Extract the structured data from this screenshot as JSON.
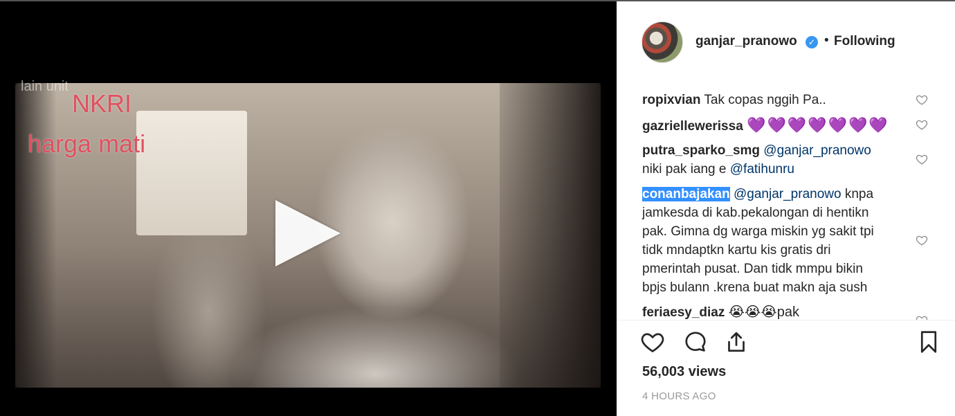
{
  "video": {
    "overlay_top": "lain unit",
    "overlay_line1": "NKRI",
    "overlay_line2": "harga mati"
  },
  "header": {
    "username": "ganjar_pranowo",
    "separator": "•",
    "follow_status": "Following"
  },
  "comments": [
    {
      "user": "ropixvian",
      "text": "Tak copas nggih Pa.."
    },
    {
      "user": "gazriellewerissa",
      "text": "💜💜💜💜💜💜💜"
    },
    {
      "user": "putra_sparko_smg",
      "mention": "@ganjar_pranowo",
      "text_line2": "niki pak iang e",
      "mention2": "@fatihunru"
    },
    {
      "user": "conanbajakan",
      "mention": "@ganjar_pranowo",
      "text_a": "knpa",
      "text_b": "jamkesda di kab.pekalongan di hentikn",
      "text_c": "pak. Gimna dg warga miskin yg sakit tpi",
      "text_d": "tidk mndaptkn kartu kis gratis dri",
      "text_e": "pmerintah pusat. Dan tidk mmpu bikin",
      "text_f": "bpjs bulann .krena buat makn aja sush"
    },
    {
      "user": "feriaesy_diaz",
      "text": "😭😭😭pak"
    }
  ],
  "stats": {
    "views": "56,003 views",
    "time": "4 HOURS AGO"
  },
  "colors": {
    "accent": "#3897f0",
    "selection": "#3390ff",
    "mention": "#003569"
  },
  "icons": [
    "play-icon",
    "verified-badge-icon",
    "heart-icon",
    "comment-icon",
    "share-icon",
    "bookmark-icon"
  ]
}
